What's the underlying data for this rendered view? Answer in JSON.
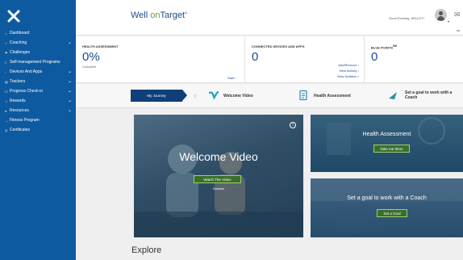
{
  "sidebar": {
    "items": [
      {
        "label": "Dashboard",
        "icon": "home-icon",
        "glyph": "⌂",
        "chevron": ""
      },
      {
        "label": "Coaching",
        "icon": "coaching-icon",
        "glyph": "✓",
        "chevron": "⌄"
      },
      {
        "label": "Challenges",
        "icon": "challenges-icon",
        "glyph": "⚑",
        "chevron": ""
      },
      {
        "label": "Self-management Programs",
        "icon": "programs-icon",
        "glyph": "≡",
        "chevron": ""
      },
      {
        "label": "Devices And Apps",
        "icon": "devices-icon",
        "glyph": "▫",
        "chevron": "⌄"
      },
      {
        "label": "Trackers",
        "icon": "trackers-icon",
        "glyph": "▤",
        "chevron": "⌄"
      },
      {
        "label": "Progress Check-in",
        "icon": "checkin-icon",
        "glyph": "☐",
        "chevron": "⌄"
      },
      {
        "label": "Rewards",
        "icon": "rewards-icon",
        "glyph": "☆",
        "chevron": "⌄"
      },
      {
        "label": "Resources",
        "icon": "resources-icon",
        "glyph": "●",
        "chevron": "⌄"
      },
      {
        "label": "Fitness Program",
        "icon": "fitness-icon",
        "glyph": "↔",
        "chevron": ""
      },
      {
        "label": "Certificates",
        "icon": "certificates-icon",
        "glyph": "◎",
        "chevron": ""
      }
    ]
  },
  "header": {
    "logo_left": "Well ",
    "logo_on": "on",
    "logo_right": "Target",
    "logo_mark": "®",
    "greeting": "Good Evening, KELLEY!",
    "header_icon_text": "co"
  },
  "stats": {
    "health": {
      "title": "HEALTH ASSESSMENT",
      "value": "0%",
      "sub": "Complete",
      "link": "Start ›"
    },
    "devices": {
      "title": "CONNECTED DEVICES AND APPS",
      "value": "0",
      "links": [
        "Add/Remove ›",
        "View Activity ›",
        "View Nutrition ›"
      ]
    },
    "points": {
      "title": "BLUE POINTS",
      "title_mark": "SM",
      "value": "0"
    }
  },
  "steps": {
    "journey": "My Journey",
    "items": [
      {
        "label": "Welcome Video"
      },
      {
        "label": "Health Assessment"
      },
      {
        "label": "Set a goal to work with a Coach"
      }
    ]
  },
  "tiles": {
    "video": {
      "title": "Welcome Video",
      "button": "Watch The Video",
      "dismiss": "Dismiss",
      "info": "i"
    },
    "health": {
      "title": "Health Assessment",
      "button": "Take me there"
    },
    "goal": {
      "title": "Set a goal to work with a Coach",
      "button": "Set a Goal"
    }
  },
  "explore": "Explore",
  "colors": {
    "sidebar": "#0e5aa0",
    "brand_blue": "#1a4b8c",
    "brand_green": "#6a9a2e",
    "button_green": "#3a6e2e"
  }
}
